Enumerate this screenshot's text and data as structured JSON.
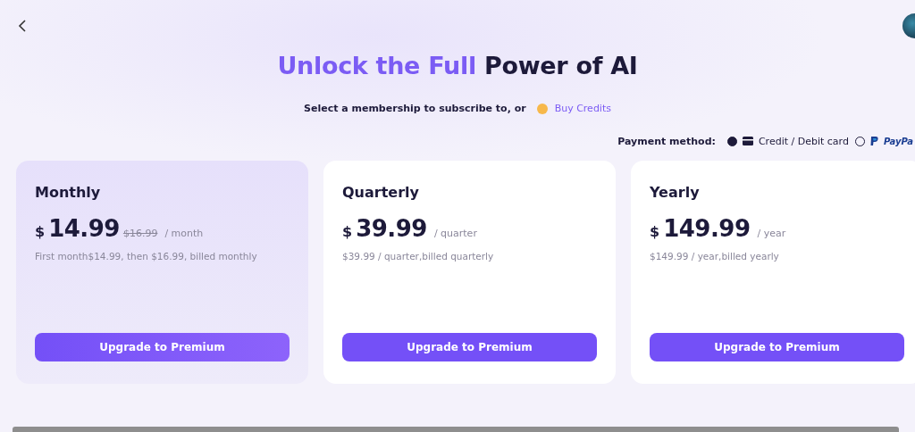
{
  "header": {
    "title_highlight": "Unlock the Full",
    "title_rest": "Power of AI",
    "subtitle": "Select a membership to subscribe to, or",
    "credits_link": "Buy Credits"
  },
  "payment": {
    "label": "Payment method:",
    "options": [
      {
        "kind": "card",
        "label": "Credit / Debit card",
        "selected": true
      },
      {
        "kind": "paypal",
        "label": "PayPa",
        "selected": false
      }
    ]
  },
  "plans": [
    {
      "name": "Monthly",
      "currency": "$",
      "price": "14.99",
      "old_price": "$16.99",
      "period": "/ month",
      "note": "First month$14.99, then $16.99, billed monthly",
      "button": "Upgrade to Premium",
      "selected": true
    },
    {
      "name": "Quarterly",
      "currency": "$",
      "price": "39.99",
      "period": "/ quarter",
      "note": "$39.99 / quarter,billed quarterly",
      "button": "Upgrade to Premium",
      "selected": false
    },
    {
      "name": "Yearly",
      "currency": "$",
      "price": "149.99",
      "period": "/ year",
      "note": "$149.99 / year,billed yearly",
      "button": "Upgrade to Premium",
      "selected": false
    }
  ]
}
